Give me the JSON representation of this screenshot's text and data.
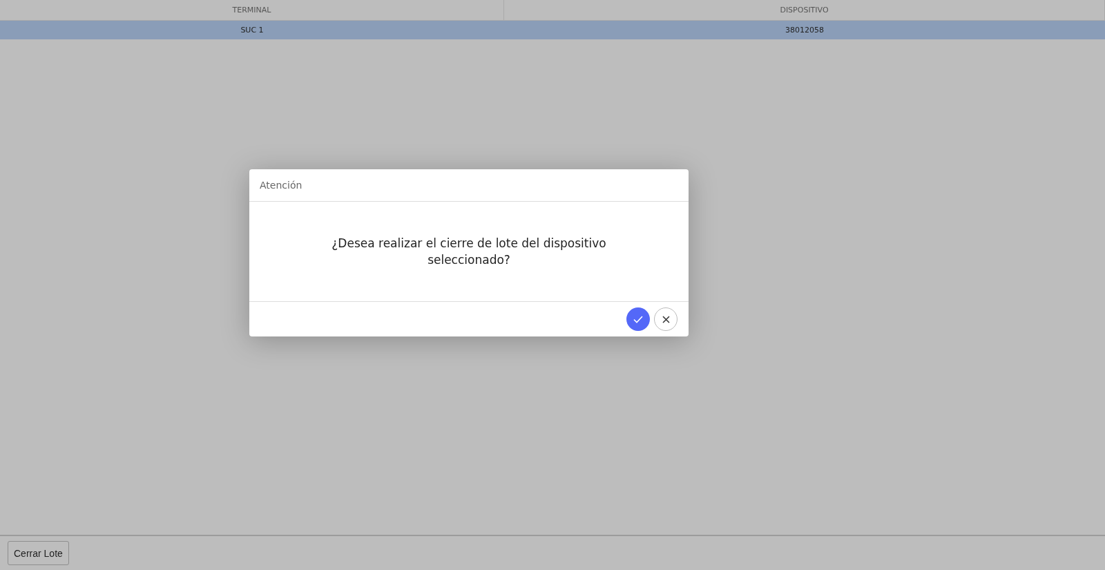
{
  "table": {
    "columns": [
      "TERMINAL",
      "DISPOSITIVO"
    ],
    "rows": [
      {
        "cells": [
          "SUC 1",
          "38012058"
        ],
        "selected": true
      }
    ]
  },
  "dialog": {
    "title": "Atención",
    "message": "¿Desea realizar el cierre de lote del dispositivo seleccionado?",
    "actions": [
      {
        "kind": "confirm"
      },
      {
        "kind": "cancel"
      }
    ]
  },
  "footer": {
    "buttons": [
      "Cerrar Lote"
    ]
  }
}
